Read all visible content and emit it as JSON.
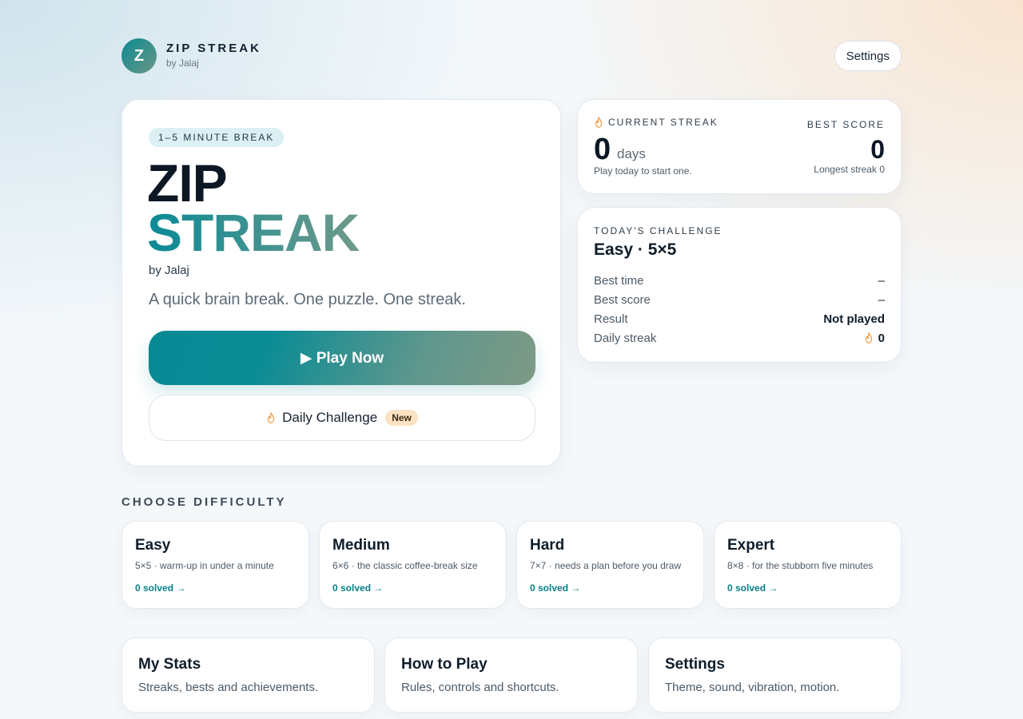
{
  "header": {
    "logo_letter": "Z",
    "title": "ZIP STREAK",
    "byline": "by Jalaj",
    "settings_label": "Settings"
  },
  "hero": {
    "pill": "1–5 MINUTE BREAK",
    "title_line1": "ZIP",
    "title_line2": "STREAK",
    "byline": "by Jalaj",
    "tagline": "A quick brain break. One puzzle. One streak.",
    "play_label": "▶ Play Now",
    "daily_label": "Daily Challenge",
    "daily_badge": "New"
  },
  "streak": {
    "current_label": "CURRENT STREAK",
    "current_value": "0",
    "current_unit": "days",
    "current_hint": "Play today to start one.",
    "best_label": "BEST SCORE",
    "best_value": "0",
    "best_hint": "Longest streak 0"
  },
  "challenge": {
    "label": "TODAY'S CHALLENGE",
    "title": "Easy · 5×5",
    "rows": [
      {
        "key": "Best time",
        "value": "–"
      },
      {
        "key": "Best score",
        "value": "–"
      },
      {
        "key": "Result",
        "value": "Not played"
      },
      {
        "key": "Daily streak",
        "value": "0"
      }
    ]
  },
  "difficulty": {
    "label": "CHOOSE DIFFICULTY",
    "items": [
      {
        "name": "Easy",
        "desc": "5×5 · warm-up in under a minute",
        "solved": "0 solved →"
      },
      {
        "name": "Medium",
        "desc": "6×6 · the classic coffee-break size",
        "solved": "0 solved →"
      },
      {
        "name": "Hard",
        "desc": "7×7 · needs a plan before you draw",
        "solved": "0 solved →"
      },
      {
        "name": "Expert",
        "desc": "8×8 · for the stubborn five minutes",
        "solved": "0 solved →"
      }
    ]
  },
  "tiles": [
    {
      "title": "My Stats",
      "desc": "Streaks, bests and achievements."
    },
    {
      "title": "How to Play",
      "desc": "Rules, controls and shortcuts."
    },
    {
      "title": "Settings",
      "desc": "Theme, sound, vibration, motion."
    }
  ],
  "colors": {
    "accent_teal": "#0a8a96",
    "accent_sage": "#7e9a85",
    "flame": "#f0a04a"
  },
  "icons": {
    "flame": "flame-icon",
    "play": "play-icon"
  }
}
